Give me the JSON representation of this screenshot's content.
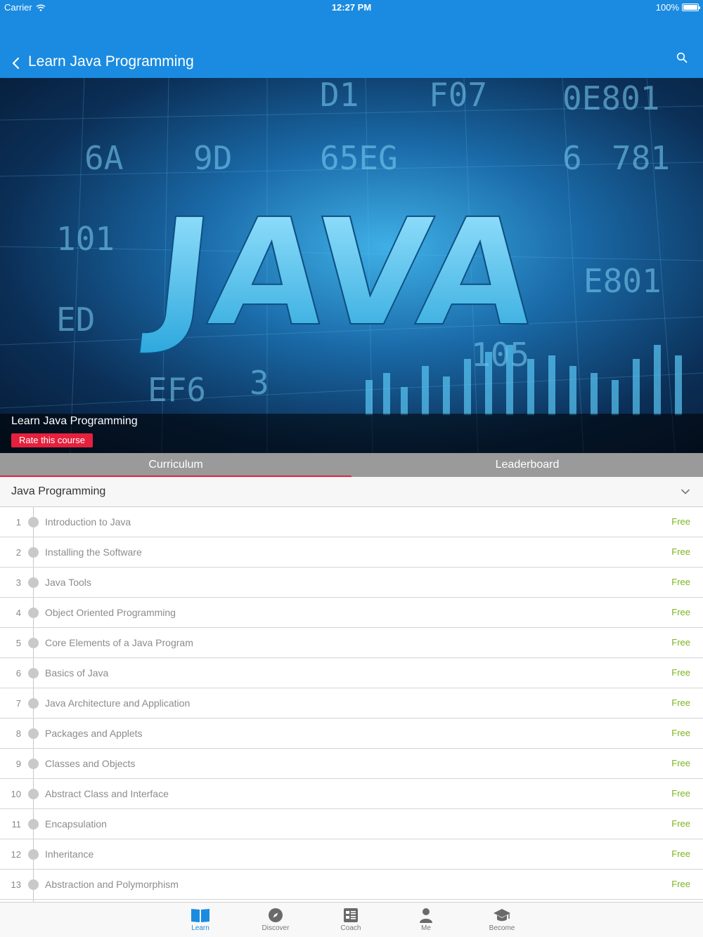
{
  "status_bar": {
    "carrier": "Carrier",
    "time": "12:27 PM",
    "battery": "100%"
  },
  "nav": {
    "title": "Learn Java Programming"
  },
  "hero": {
    "big_text": "JAVA",
    "hex_snippets": [
      "D1",
      "F07",
      "0E801",
      "65EG",
      "9D",
      "6A",
      "101",
      "ED",
      "6",
      "781",
      "E801",
      "105",
      "EF6",
      "3"
    ],
    "course_name": "Learn Java Programming",
    "rate_button": "Rate this course"
  },
  "tabs": [
    {
      "label": "Curriculum",
      "active": true
    },
    {
      "label": "Leaderboard",
      "active": false
    }
  ],
  "section": {
    "title": "Java Programming"
  },
  "lessons": [
    {
      "num": "1",
      "title": "Introduction to Java",
      "price": "Free"
    },
    {
      "num": "2",
      "title": "Installing the Software",
      "price": "Free"
    },
    {
      "num": "3",
      "title": "Java Tools",
      "price": "Free"
    },
    {
      "num": "4",
      "title": "Object Oriented Programming",
      "price": "Free"
    },
    {
      "num": "5",
      "title": "Core Elements of a Java Program",
      "price": "Free"
    },
    {
      "num": "6",
      "title": "Basics of Java",
      "price": "Free"
    },
    {
      "num": "7",
      "title": "Java Architecture and Application",
      "price": "Free"
    },
    {
      "num": "8",
      "title": "Packages and Applets",
      "price": "Free"
    },
    {
      "num": "9",
      "title": "Classes and Objects",
      "price": "Free"
    },
    {
      "num": "10",
      "title": "Abstract Class and Interface",
      "price": "Free"
    },
    {
      "num": "11",
      "title": "Encapsulation",
      "price": "Free"
    },
    {
      "num": "12",
      "title": "Inheritance",
      "price": "Free"
    },
    {
      "num": "13",
      "title": "Abstraction and Polymorphism",
      "price": "Free"
    }
  ],
  "tabbar": [
    {
      "label": "Learn",
      "icon": "book-icon",
      "active": true
    },
    {
      "label": "Discover",
      "icon": "compass-icon",
      "active": false
    },
    {
      "label": "Coach",
      "icon": "clipboard-icon",
      "active": false
    },
    {
      "label": "Me",
      "icon": "person-icon",
      "active": false
    },
    {
      "label": "Become",
      "icon": "graduation-cap-icon",
      "active": false
    }
  ],
  "colors": {
    "primary": "#1a8be0",
    "accent_red": "#e5213e",
    "free_green": "#7ab51d",
    "tab_gray": "#9a9a9a"
  }
}
